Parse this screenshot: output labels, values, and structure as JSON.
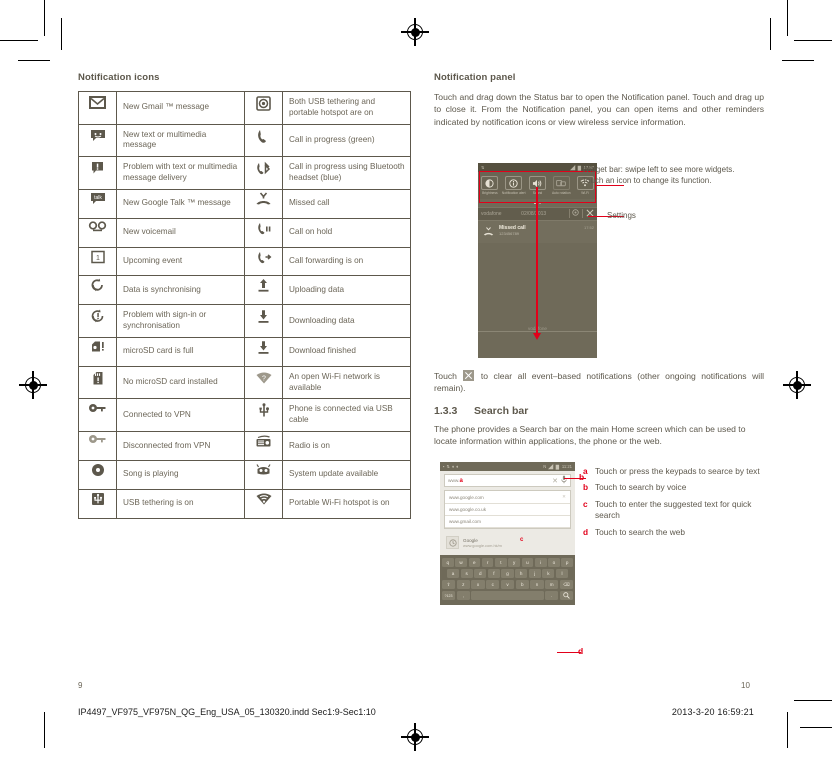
{
  "left_column": {
    "heading": "Notification icons",
    "rows": [
      {
        "l_icon": "gmail-icon",
        "l_text": "New Gmail ™ message",
        "r_icon": "usb-tether-hotspot-icon",
        "r_text": "Both USB tethering and portable hotspot are on"
      },
      {
        "l_icon": "sms-message-icon",
        "l_text": "New text or multimedia message",
        "r_icon": "call-in-progress-icon",
        "r_text": "Call in progress (green)"
      },
      {
        "l_icon": "message-problem-icon",
        "l_text": "Problem with text or multimedia message delivery",
        "r_icon": "bluetooth-call-icon",
        "r_text": "Call in progress using Bluetooth headset (blue)"
      },
      {
        "l_icon": "google-talk-icon",
        "l_text": "New Google Talk ™ message",
        "r_icon": "missed-call-icon",
        "r_text": "Missed call"
      },
      {
        "l_icon": "voicemail-icon",
        "l_text": "New voicemail",
        "r_icon": "call-on-hold-icon",
        "r_text": "Call on hold"
      },
      {
        "l_icon": "calendar-event-icon",
        "l_text": "Upcoming event",
        "r_icon": "call-forwarding-icon",
        "r_text": "Call forwarding is on"
      },
      {
        "l_icon": "sync-icon",
        "l_text": "Data is synchronising",
        "r_icon": "upload-icon",
        "r_text": "Uploading data"
      },
      {
        "l_icon": "sync-problem-icon",
        "l_text": "Problem with sign-in or synchronisation",
        "r_icon": "download-icon",
        "r_text": "Downloading data"
      },
      {
        "l_icon": "sdcard-full-icon",
        "l_text": "microSD card is full",
        "r_icon": "download-finished-icon",
        "r_text": "Download finished"
      },
      {
        "l_icon": "no-sdcard-icon",
        "l_text": "No microSD card installed",
        "r_icon": "open-wifi-icon",
        "r_text": "An open Wi-Fi network is available"
      },
      {
        "l_icon": "vpn-connected-icon",
        "l_text": "Connected to VPN",
        "r_icon": "usb-cable-icon",
        "r_text": "Phone is connected via USB cable"
      },
      {
        "l_icon": "vpn-disconnected-icon",
        "l_text": "Disconnected from VPN",
        "r_icon": "radio-icon",
        "r_text": "Radio is on"
      },
      {
        "l_icon": "music-playing-icon",
        "l_text": "Song is playing",
        "r_icon": "system-update-icon",
        "r_text": "System update available"
      },
      {
        "l_icon": "usb-tethering-icon",
        "l_text": "USB tethering is on",
        "r_icon": "wifi-hotspot-icon",
        "r_text": "Portable Wi-Fi hotspot is on"
      }
    ]
  },
  "right_column": {
    "heading": "Notification panel",
    "paragraph_1": "Touch and drag down the Status bar to open the Notification panel. Touch and drag up to close it. From the Notification panel, you can open items and other reminders indicated by notification icons or view wireless service information.",
    "clear_note_before": "Touch",
    "clear_note_after": "to clear all event–based notifications (other ongoing notifications will remain).",
    "section_number": "1.3.3",
    "section_title": "Search bar",
    "paragraph_2": "The phone provides a Search bar on the main Home screen which can be used to locate information within applications, the phone or the web.",
    "callout_widget_bar": "Widget bar: swipe left to see more widgets. Touch an icon to change its function.",
    "callout_settings": "Settings"
  },
  "phone_notification_panel": {
    "status_bar": {
      "time": "17:57"
    },
    "widgets": [
      {
        "name": "brightness-widget",
        "label": "Brightness"
      },
      {
        "name": "notification-alert-widget",
        "label": "Notification alert"
      },
      {
        "name": "sound-widget",
        "label": "Sound"
      },
      {
        "name": "auto-rotation-widget",
        "label": "Auto rotation"
      },
      {
        "name": "wifi-widget",
        "label": "Wi-Fi"
      }
    ],
    "carrier": "vodafone",
    "date": "02/08/2013",
    "notification": {
      "title": "Missed call",
      "number": "123456789",
      "time": "17:52"
    },
    "footer_carrier": "vodafone"
  },
  "phone_search_bar": {
    "status_bar": {
      "time": "11:21"
    },
    "search_value": "www.",
    "marker_a": "a",
    "marker_c": "c",
    "suggestions": [
      "www.google.com",
      "www.google.co.uk",
      "www.gmail.com"
    ],
    "engine_row": {
      "title": "Google",
      "url": "www.google.com.hk/m"
    },
    "keyboard": {
      "row1": [
        "q",
        "w",
        "e",
        "r",
        "t",
        "y",
        "u",
        "i",
        "o",
        "p"
      ],
      "row2": [
        "a",
        "s",
        "d",
        "f",
        "g",
        "h",
        "j",
        "k",
        "l"
      ],
      "row3": [
        "⇧",
        "z",
        "x",
        "c",
        "v",
        "b",
        "n",
        "m",
        "⌫"
      ],
      "row4": [
        "?123",
        ",",
        "",
        "."
      ]
    }
  },
  "legend": [
    {
      "key": "a",
      "text": "Touch or press the keypads to searce by text"
    },
    {
      "key": "b",
      "text": "Touch to search by voice"
    },
    {
      "key": "c",
      "text": "Touch to enter the suggested text for quick search"
    },
    {
      "key": "d",
      "text": "Touch to search the web"
    }
  ],
  "annotation_letters": {
    "b": "b",
    "d": "d"
  },
  "footer": {
    "page_left": "9",
    "page_right": "10",
    "file_name": "IP4497_VF975_VF975N_QG_Eng_USA_05_130320.indd   Sec1:9-Sec1:10",
    "date_stamp": "2013-3-20   16:59:21"
  },
  "colors": {
    "ink": "#5d584c",
    "accent_red": "#e2001a",
    "phone_bg": "#6f6a59",
    "rule": "#5d584c"
  }
}
